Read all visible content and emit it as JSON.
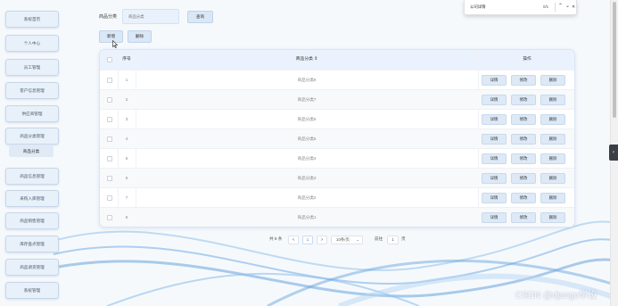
{
  "sidebar": {
    "items": [
      {
        "label": "系统首页"
      },
      {
        "label": "个人中心"
      },
      {
        "label": "员工管理"
      },
      {
        "label": "客户信息管理"
      },
      {
        "label": "供应商管理"
      },
      {
        "label": "商品分类管理"
      },
      {
        "label": "商品信息管理"
      },
      {
        "label": "采购入库管理"
      },
      {
        "label": "商品销售管理"
      },
      {
        "label": "库存盘点管理"
      },
      {
        "label": "商品调货管理"
      },
      {
        "label": "系统管理"
      }
    ],
    "submenu": {
      "label": "商品分类"
    }
  },
  "toolbar": {
    "filter_label": "商品分类",
    "filter_placeholder": "商品分类",
    "search_label": "查询",
    "add_label": "新增",
    "delete_label": "删除"
  },
  "table": {
    "headers": {
      "index": "序号",
      "category": "商品分类 ⇕",
      "actions": "操作"
    },
    "action_labels": {
      "detail": "详情",
      "edit": "修改",
      "delete": "删除"
    },
    "rows": [
      {
        "index": "1",
        "category": "商品分类8"
      },
      {
        "index": "2",
        "category": "商品分类7"
      },
      {
        "index": "3",
        "category": "商品分类6"
      },
      {
        "index": "4",
        "category": "商品分类5"
      },
      {
        "index": "5",
        "category": "商品分类4"
      },
      {
        "index": "6",
        "category": "商品分类3"
      },
      {
        "index": "7",
        "category": "商品分类2"
      },
      {
        "index": "8",
        "category": "商品分类1"
      }
    ]
  },
  "pagination": {
    "total": "共 8 条",
    "prev": "<",
    "current_page": "1",
    "next": ">",
    "page_size": "10条/页",
    "page_size_arrow": "⌄",
    "goto_label": "前往",
    "goto_value": "1",
    "goto_suffix": "页"
  },
  "findbar": {
    "query": "公司详情",
    "count": "0/1",
    "up": "⌃",
    "down": "⌄",
    "close": "✕"
  },
  "side_tab": "‹",
  "watermark": "CSDN @django毕设",
  "colors": {
    "accent": "#d9e7f6",
    "header_bg": "#eaf3fd",
    "page_bg": "#f6f9fc",
    "wave": "#7db3e6"
  }
}
